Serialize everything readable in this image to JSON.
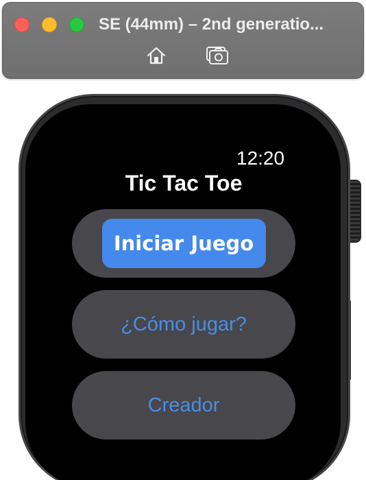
{
  "window": {
    "title": "SE (44mm) – 2nd generatio...",
    "controls": [
      "close",
      "minimize",
      "maximize"
    ],
    "toolbar_icons": [
      "home-icon",
      "screenshot-camera-icon"
    ]
  },
  "watch": {
    "time": "12:20",
    "app_title": "Tic Tac Toe",
    "buttons": [
      {
        "label": "Iniciar Juego",
        "style": "primary"
      },
      {
        "label": "¿Cómo jugar?",
        "style": "secondary"
      },
      {
        "label": "Creador",
        "style": "secondary"
      }
    ]
  },
  "colors": {
    "accent": "#4489eb",
    "button_background": "#47474c",
    "link_text": "#4a8ee4",
    "screen_background": "#000000"
  }
}
